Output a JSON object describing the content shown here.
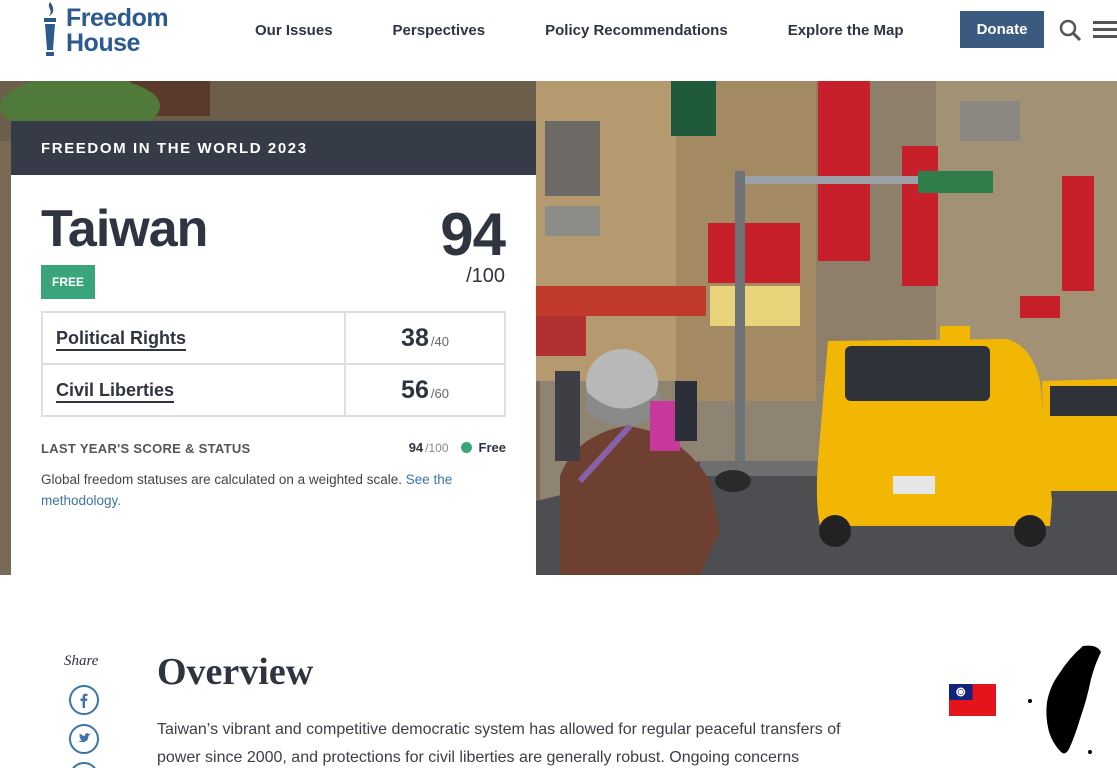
{
  "header": {
    "logo_line1": "Freedom",
    "logo_line2": "House",
    "nav": [
      "Our Issues",
      "Perspectives",
      "Policy Recommendations",
      "Explore the Map"
    ],
    "donate_label": "Donate"
  },
  "hero": {
    "colors": {
      "sky": "#9b8f7c",
      "taxi": "#f2b705",
      "sign_red": "#c8202a"
    }
  },
  "card": {
    "band": "FREEDOM IN THE WORLD 2023",
    "country": "Taiwan",
    "status": "FREE",
    "score": "94",
    "score_max": "/100",
    "rows": [
      {
        "label": "Political Rights",
        "score": "38",
        "max": "/40"
      },
      {
        "label": "Civil Liberties",
        "score": "56",
        "max": "/60"
      }
    ],
    "last_year_label": "LAST YEAR'S SCORE & STATUS",
    "last_year_score": "94",
    "last_year_max": "/100",
    "last_year_status": "Free",
    "note_text": "Global freedom statuses are calculated on a weighted scale. ",
    "note_link": "See the methodology."
  },
  "share": {
    "label": "Share",
    "buttons": [
      "facebook-icon",
      "twitter-icon"
    ]
  },
  "overview": {
    "title": "Overview",
    "text": "Taiwan’s vibrant and competitive democratic system has allowed for regular peaceful transfers of power since 2000, and protections for civil liberties are generally robust. Ongoing concerns"
  },
  "colors": {
    "accent": "#3a5a80",
    "free_green": "#3aa57a",
    "band": "#353c47",
    "link": "#3c73a8"
  }
}
